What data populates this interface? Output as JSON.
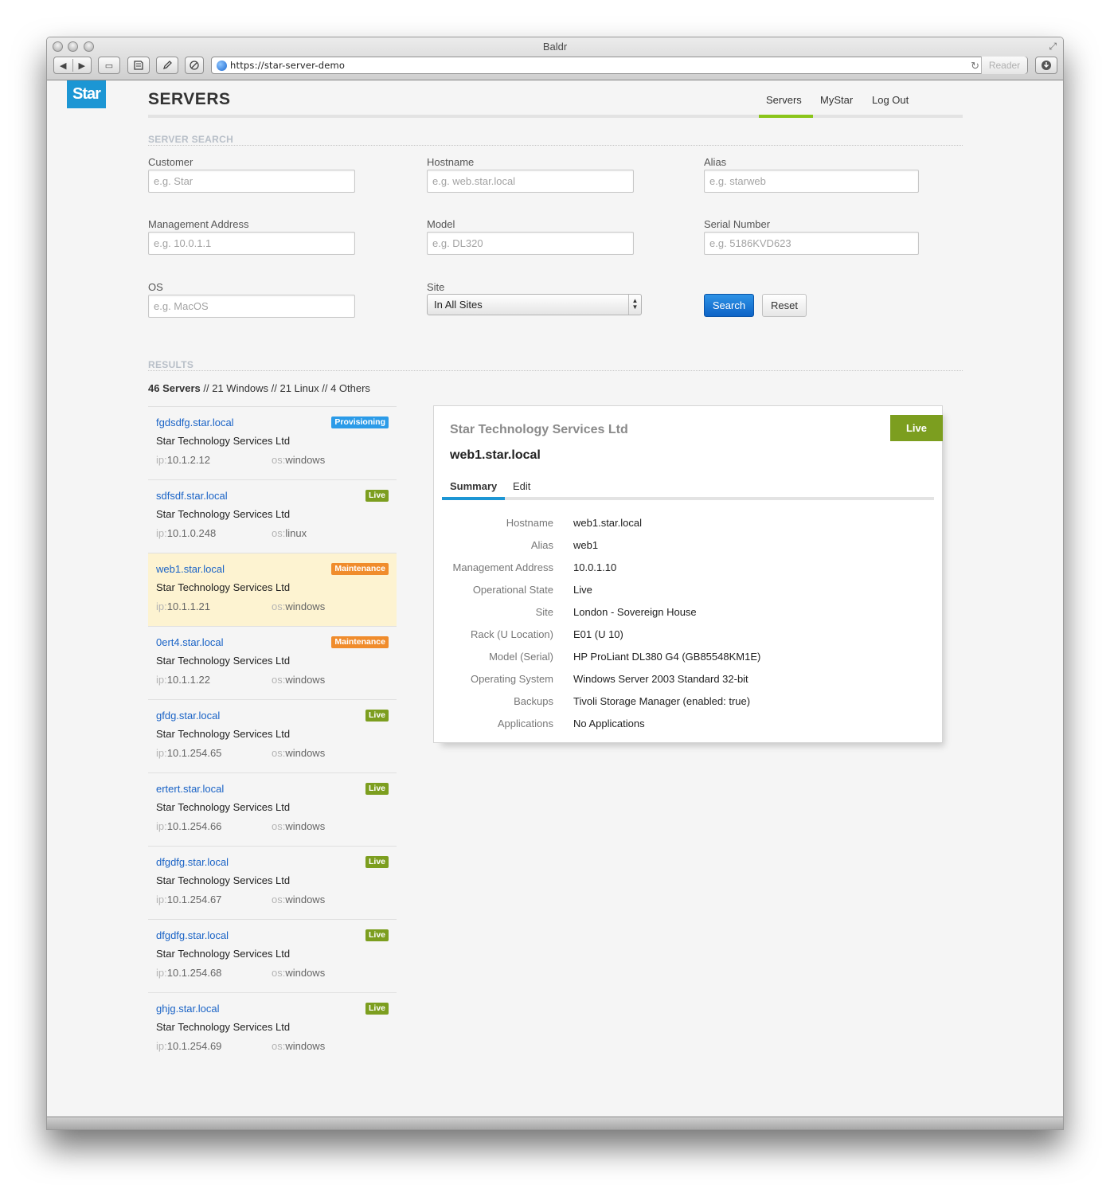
{
  "window": {
    "title": "Baldr",
    "url": "https://star-server-demo",
    "reader_label": "Reader"
  },
  "app": {
    "logo_text": "Star",
    "page_title": "SERVERS"
  },
  "nav": {
    "items": [
      {
        "label": "Servers",
        "active": true
      },
      {
        "label": "MyStar"
      },
      {
        "label": "Log Out"
      }
    ]
  },
  "search": {
    "section_label": "SERVER SEARCH",
    "fields": {
      "customer": {
        "label": "Customer",
        "placeholder": "e.g. Star"
      },
      "hostname": {
        "label": "Hostname",
        "placeholder": "e.g. web.star.local"
      },
      "alias": {
        "label": "Alias",
        "placeholder": "e.g. starweb"
      },
      "management_address": {
        "label": "Management Address",
        "placeholder": "e.g. 10.0.1.1"
      },
      "model": {
        "label": "Model",
        "placeholder": "e.g. DL320"
      },
      "serial_number": {
        "label": "Serial Number",
        "placeholder": "e.g. 5186KVD623"
      },
      "os": {
        "label": "OS",
        "placeholder": "e.g. MacOS"
      },
      "site": {
        "label": "Site",
        "selected": "In All Sites"
      }
    },
    "search_button": "Search",
    "reset_button": "Reset"
  },
  "results": {
    "section_label": "RESULTS",
    "summary": {
      "servers": "46 Servers",
      "rest": " // 21 Windows // 21 Linux // 4 Others"
    },
    "ip_key": "ip:",
    "os_key": "os:",
    "items": [
      {
        "hostname": "fgdsdfg.star.local",
        "customer": "Star Technology Services Ltd",
        "ip": "10.1.2.12",
        "os": "windows",
        "status": "Provisioning",
        "status_color": "#2b9be8"
      },
      {
        "hostname": "sdfsdf.star.local",
        "customer": "Star Technology Services Ltd",
        "ip": "10.1.0.248",
        "os": "linux",
        "status": "Live",
        "status_color": "#7c9e1f"
      },
      {
        "hostname": "web1.star.local",
        "customer": "Star Technology Services Ltd",
        "ip": "10.1.1.21",
        "os": "windows",
        "status": "Maintenance",
        "status_color": "#f08c2c",
        "selected": true
      },
      {
        "hostname": "0ert4.star.local",
        "customer": "Star Technology Services Ltd",
        "ip": "10.1.1.22",
        "os": "windows",
        "status": "Maintenance",
        "status_color": "#f08c2c"
      },
      {
        "hostname": "gfdg.star.local",
        "customer": "Star Technology Services Ltd",
        "ip": "10.1.254.65",
        "os": "windows",
        "status": "Live",
        "status_color": "#7c9e1f"
      },
      {
        "hostname": "ertert.star.local",
        "customer": "Star Technology Services Ltd",
        "ip": "10.1.254.66",
        "os": "windows",
        "status": "Live",
        "status_color": "#7c9e1f"
      },
      {
        "hostname": "dfgdfg.star.local",
        "customer": "Star Technology Services Ltd",
        "ip": "10.1.254.67",
        "os": "windows",
        "status": "Live",
        "status_color": "#7c9e1f"
      },
      {
        "hostname": "dfgdfg.star.local",
        "customer": "Star Technology Services Ltd",
        "ip": "10.1.254.68",
        "os": "windows",
        "status": "Live",
        "status_color": "#7c9e1f"
      },
      {
        "hostname": "ghjg.star.local",
        "customer": "Star Technology Services Ltd",
        "ip": "10.1.254.69",
        "os": "windows",
        "status": "Live",
        "status_color": "#7c9e1f"
      }
    ]
  },
  "detail": {
    "company": "Star Technology Services Ltd",
    "hostname": "web1.star.local",
    "status": "Live",
    "status_color": "#7c9e1f",
    "tabs": [
      {
        "label": "Summary",
        "active": true
      },
      {
        "label": "Edit"
      }
    ],
    "rows": [
      {
        "label": "Hostname",
        "value": "web1.star.local"
      },
      {
        "label": "Alias",
        "value": "web1"
      },
      {
        "label": "Management Address",
        "value": "10.0.1.10"
      },
      {
        "label": "Operational State",
        "value": "Live"
      },
      {
        "label": "Site",
        "value": "London - Sovereign House"
      },
      {
        "label": "Rack (U Location)",
        "value": "E01 (U 10)"
      },
      {
        "label": "Model (Serial)",
        "value": "HP ProLiant DL380 G4 (GB85548KM1E)"
      },
      {
        "label": "Operating System",
        "value": "Windows Server 2003 Standard 32-bit"
      },
      {
        "label": "Backups",
        "value": "Tivoli Storage Manager (enabled: true)"
      },
      {
        "label": "Applications",
        "value": "No Applications"
      }
    ]
  },
  "icons": {
    "back": "◀",
    "forward": "▶",
    "sidebar": "▭",
    "reload": "↻",
    "resize": "⤢"
  }
}
